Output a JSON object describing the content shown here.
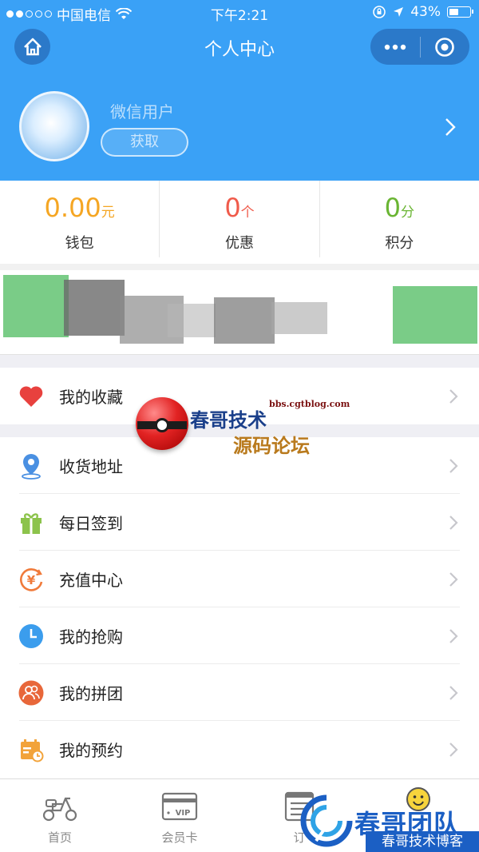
{
  "status_bar": {
    "carrier": "中国电信",
    "time": "下午2:21",
    "battery": "43%"
  },
  "nav": {
    "title": "个人中心"
  },
  "profile": {
    "username": "微信用户",
    "button_label": "获取"
  },
  "stats": [
    {
      "value": "0.00",
      "unit": "元",
      "label": "钱包",
      "color": "#f5a623"
    },
    {
      "value": "0",
      "unit": "个",
      "label": "优惠",
      "color": "#f05b4b"
    },
    {
      "value": "0",
      "unit": "分",
      "label": "积分",
      "color": "#6ab533"
    }
  ],
  "menu": {
    "favorites": {
      "label": "我的收藏",
      "icon": "heart-icon"
    },
    "items": [
      {
        "label": "收货地址",
        "icon": "location-pin-icon"
      },
      {
        "label": "每日签到",
        "icon": "gift-icon"
      },
      {
        "label": "充值中心",
        "icon": "yen-recharge-icon"
      },
      {
        "label": "我的抢购",
        "icon": "clock-icon"
      },
      {
        "label": "我的拼团",
        "icon": "group-users-icon"
      },
      {
        "label": "我的预约",
        "icon": "calendar-icon"
      }
    ]
  },
  "tabbar": {
    "tabs": [
      {
        "label": "首页",
        "icon": "scooter-icon"
      },
      {
        "label": "会员卡",
        "icon": "vip-card-icon"
      },
      {
        "label": "订",
        "icon": "order-list-icon"
      },
      {
        "label": "",
        "icon": "smiley-icon"
      }
    ]
  },
  "watermark": {
    "url": "bbs.cgtblog.com",
    "title1": "春哥技术",
    "title2": "源码论坛",
    "brand": "春哥团队",
    "brand_sub": "春哥技术博客"
  },
  "colors": {
    "header_bg": "#3aa1f6",
    "capsule_bg": "#2b79c9"
  }
}
